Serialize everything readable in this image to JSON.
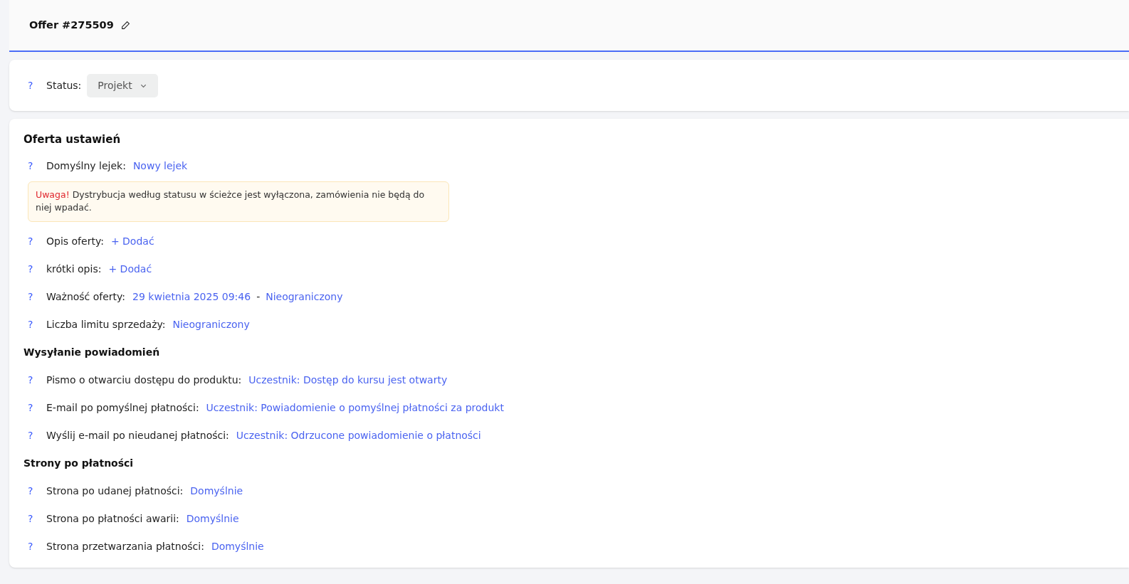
{
  "header": {
    "title": "Offer #275509"
  },
  "status": {
    "help": "?",
    "label": "Status:",
    "value": "Projekt"
  },
  "settings": {
    "title": "Oferta ustawień",
    "items": [
      {
        "kind": "field",
        "help": "?",
        "label": "Domyślny lejek:",
        "values": [
          {
            "kind": "link",
            "text": "Nowy lejek"
          }
        ]
      },
      {
        "kind": "warning",
        "strong": "Uwaga!",
        "text": "Dystrybucja według statusu w ścieżce jest wyłączona, zamówienia nie będą do niej wpadać."
      },
      {
        "kind": "field",
        "help": "?",
        "label": "Opis oferty:",
        "values": [
          {
            "kind": "link",
            "text": "+ Dodać"
          }
        ]
      },
      {
        "kind": "field",
        "help": "?",
        "label": "krótki opis:",
        "values": [
          {
            "kind": "link",
            "text": "+ Dodać"
          }
        ]
      },
      {
        "kind": "field",
        "help": "?",
        "label": "Ważność oferty:",
        "values": [
          {
            "kind": "link",
            "text": "29 kwietnia 2025 09:46"
          },
          {
            "kind": "separator",
            "text": "-"
          },
          {
            "kind": "link",
            "text": "Nieograniczony"
          }
        ]
      },
      {
        "kind": "field",
        "help": "?",
        "label": "Liczba limitu sprzedaży:",
        "values": [
          {
            "kind": "link",
            "text": "Nieograniczony"
          }
        ]
      },
      {
        "kind": "heading",
        "text": "Wysyłanie powiadomień"
      },
      {
        "kind": "field",
        "help": "?",
        "label": "Pismo o otwarciu dostępu do produktu:",
        "values": [
          {
            "kind": "link",
            "text": "Uczestnik: Dostęp do kursu jest otwarty"
          }
        ]
      },
      {
        "kind": "field",
        "help": "?",
        "label": "E-mail po pomyślnej płatności:",
        "values": [
          {
            "kind": "link",
            "text": "Uczestnik: Powiadomienie o pomyślnej płatności za produkt"
          }
        ]
      },
      {
        "kind": "field",
        "help": "?",
        "label": "Wyślij e-mail po nieudanej płatności:",
        "values": [
          {
            "kind": "link",
            "text": "Uczestnik: Odrzucone powiadomienie o płatności"
          }
        ]
      },
      {
        "kind": "heading",
        "text": "Strony po płatności"
      },
      {
        "kind": "field",
        "help": "?",
        "label": "Strona po udanej płatności:",
        "values": [
          {
            "kind": "link",
            "text": "Domyślnie"
          }
        ]
      },
      {
        "kind": "field",
        "help": "?",
        "label": "Strona po płatności awarii:",
        "values": [
          {
            "kind": "link",
            "text": "Domyślnie"
          }
        ]
      },
      {
        "kind": "field",
        "help": "?",
        "label": "Strona przetwarzania płatności:",
        "values": [
          {
            "kind": "link",
            "text": "Domyślnie"
          }
        ]
      }
    ]
  }
}
